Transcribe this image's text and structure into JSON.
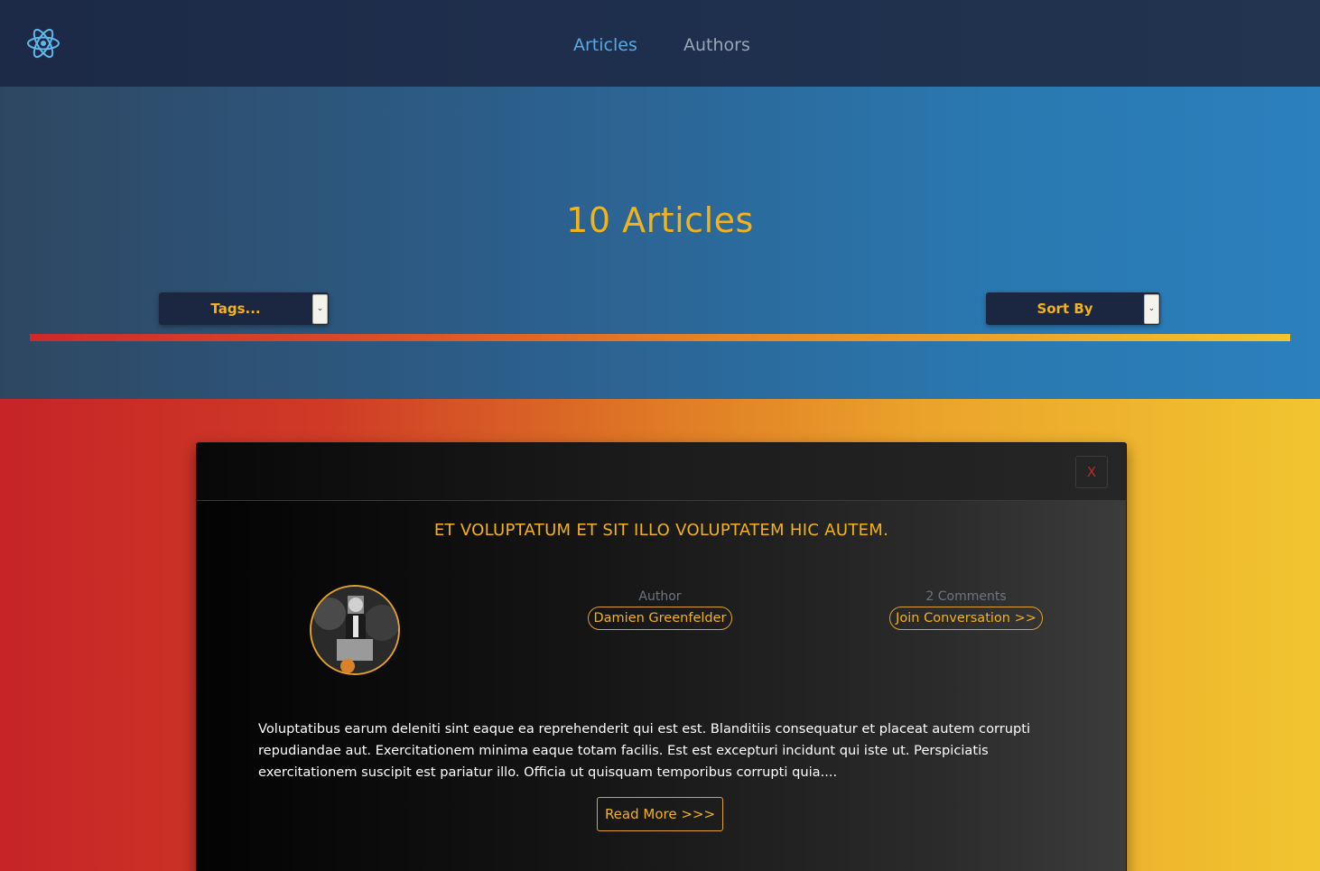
{
  "nav": {
    "logo_icon": "react-atom-icon",
    "links": [
      {
        "label": "Articles",
        "active": true
      },
      {
        "label": "Authors",
        "active": false
      }
    ]
  },
  "hero": {
    "title": "10 Articles",
    "tags_select": {
      "selected": "Tags..."
    },
    "sort_select": {
      "selected": "Sort By"
    }
  },
  "card": {
    "close_label": "X",
    "title": "ET VOLUPTATUM ET SIT ILLO VOLUPTATEM HIC AUTEM.",
    "author_label": "Author",
    "author_name": "Damien Greenfelder",
    "comments_label": "2 Comments",
    "join_label": "Join Conversation >>",
    "excerpt": "Voluptatibus earum deleniti sint eaque ea reprehenderit qui est est. Blanditiis consequatur et placeat autem corrupti repudiandae aut. Exercitationem minima eaque totam facilis. Est est excepturi incidunt qui iste ut. Perspiciatis exercitationem suscipit est pariatur illo. Officia ut quisquam temporibus corrupti quia....",
    "read_more_label": "Read More >>>"
  },
  "colors": {
    "accent": "#f2b21b",
    "nav_active": "#5aa8e6",
    "nav_inactive": "#9aa6b6",
    "close": "#c0281e"
  }
}
